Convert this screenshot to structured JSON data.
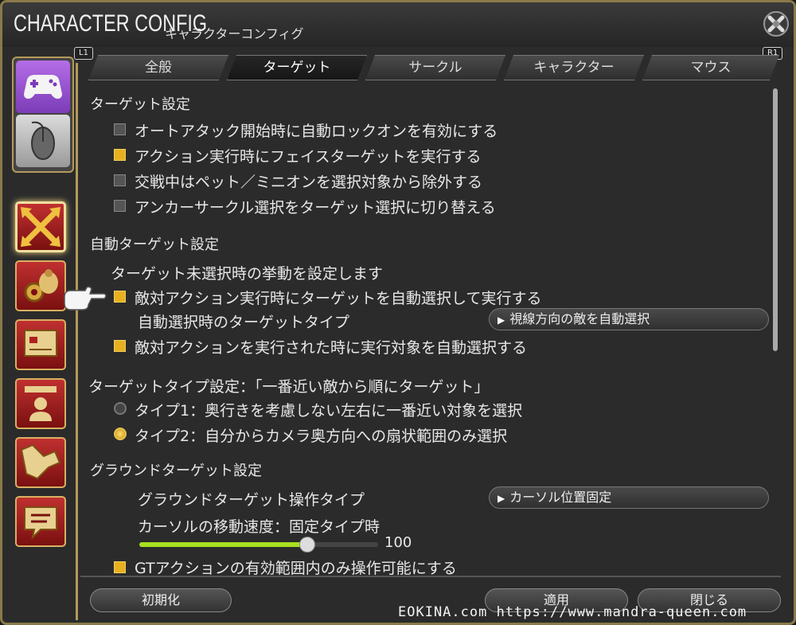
{
  "window": {
    "title": "CHARACTER CONFIG",
    "subtitle": "キャラクターコンフィグ",
    "hint_left": "L1",
    "hint_right": "R1"
  },
  "tabs": [
    {
      "label": "全般",
      "active": false
    },
    {
      "label": "ターゲット",
      "active": true
    },
    {
      "label": "サークル",
      "active": false
    },
    {
      "label": "キャラクター",
      "active": false
    },
    {
      "label": "マウス",
      "active": false
    }
  ],
  "sections": {
    "target": {
      "title": "ターゲット設定",
      "items": [
        {
          "label": "オートアタック開始時に自動ロックオンを有効にする",
          "checked": false
        },
        {
          "label": "アクション実行時にフェイスターゲットを実行する",
          "checked": true
        },
        {
          "label": "交戦中はペット／ミニオンを選択対象から除外する",
          "checked": false
        },
        {
          "label": "アンカーサークル選択をターゲット選択に切り替える",
          "checked": false
        }
      ]
    },
    "auto_target": {
      "title": "自動ターゲット設定",
      "desc": "ターゲット未選択時の挙動を設定します",
      "item1": {
        "label": "敵対アクション実行時にターゲットを自動選択して実行する",
        "checked": true
      },
      "type_label": "自動選択時のターゲットタイプ",
      "type_value": "視線方向の敵を自動選択",
      "item2": {
        "label": "敵対アクションを実行された時に実行対象を自動選択する",
        "checked": true
      }
    },
    "target_type": {
      "title": "ターゲットタイプ設定：「一番近い敵から順にターゲット」",
      "option1": {
        "label": "タイプ1：奥行きを考慮しない左右に一番近い対象を選択",
        "selected": false
      },
      "option2": {
        "label": "タイプ2：自分からカメラ奥方向への扇状範囲のみ選択",
        "selected": true
      }
    },
    "ground_target": {
      "title": "グラウンドターゲット設定",
      "op_label": "グラウンドターゲット操作タイプ",
      "op_value": "カーソル位置固定",
      "speed_label": "カーソルの移動速度：固定タイプ時",
      "speed_value": "100",
      "speed_fraction": 0.7,
      "gt_item": {
        "label": "GTアクションの有効範囲内のみ操作可能にする",
        "checked": true
      }
    }
  },
  "footer": {
    "reset": "初期化",
    "apply": "適用",
    "close": "閉じる"
  },
  "watermark": "EOKINA.com  https://www.mandra-queen.com",
  "colors": {
    "accent_gold": "#e8b020",
    "frame": "#8a7a4a",
    "slider_green": "#a8e020"
  },
  "icons": {
    "close": "close-x-icon",
    "controller": "gamepad-icon",
    "mouse": "mouse-icon",
    "pointer": "hand-pointer-icon"
  }
}
